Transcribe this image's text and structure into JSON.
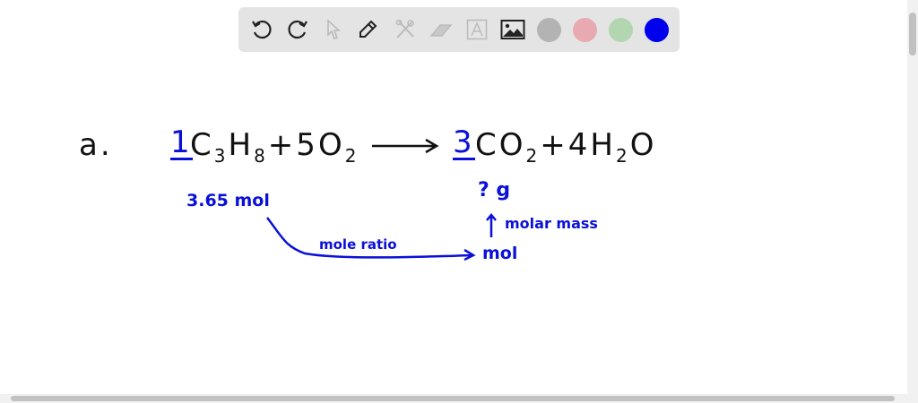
{
  "toolbar": {
    "tools": [
      "undo-icon",
      "redo-icon",
      "select-icon",
      "pen-icon",
      "tools-icon",
      "eraser-icon",
      "text-icon",
      "image-icon"
    ],
    "colors": {
      "gray": "#b3b3b3",
      "pink": "#e8a9b0",
      "green": "#b1d6b0",
      "blue": "#0000ee"
    }
  },
  "canvas": {
    "label": "a.",
    "coef_c3h8": "1",
    "c3h8": {
      "c": "C",
      "c_sub": "3",
      "h": "H",
      "h_sub": "8"
    },
    "plus1": "+",
    "o2": {
      "coef": "5",
      "o": "O",
      "sub": "2"
    },
    "coef_co2": "3",
    "co2": {
      "c": "CO",
      "sub": "2"
    },
    "plus2": "+",
    "h2o": {
      "coef": "4",
      "h": "H",
      "sub": "2",
      "o": "O"
    },
    "given": "3.65 mol",
    "unknown": "? g",
    "molar_mass": "molar mass",
    "mole_ratio": "mole ratio",
    "mol": "mol"
  }
}
